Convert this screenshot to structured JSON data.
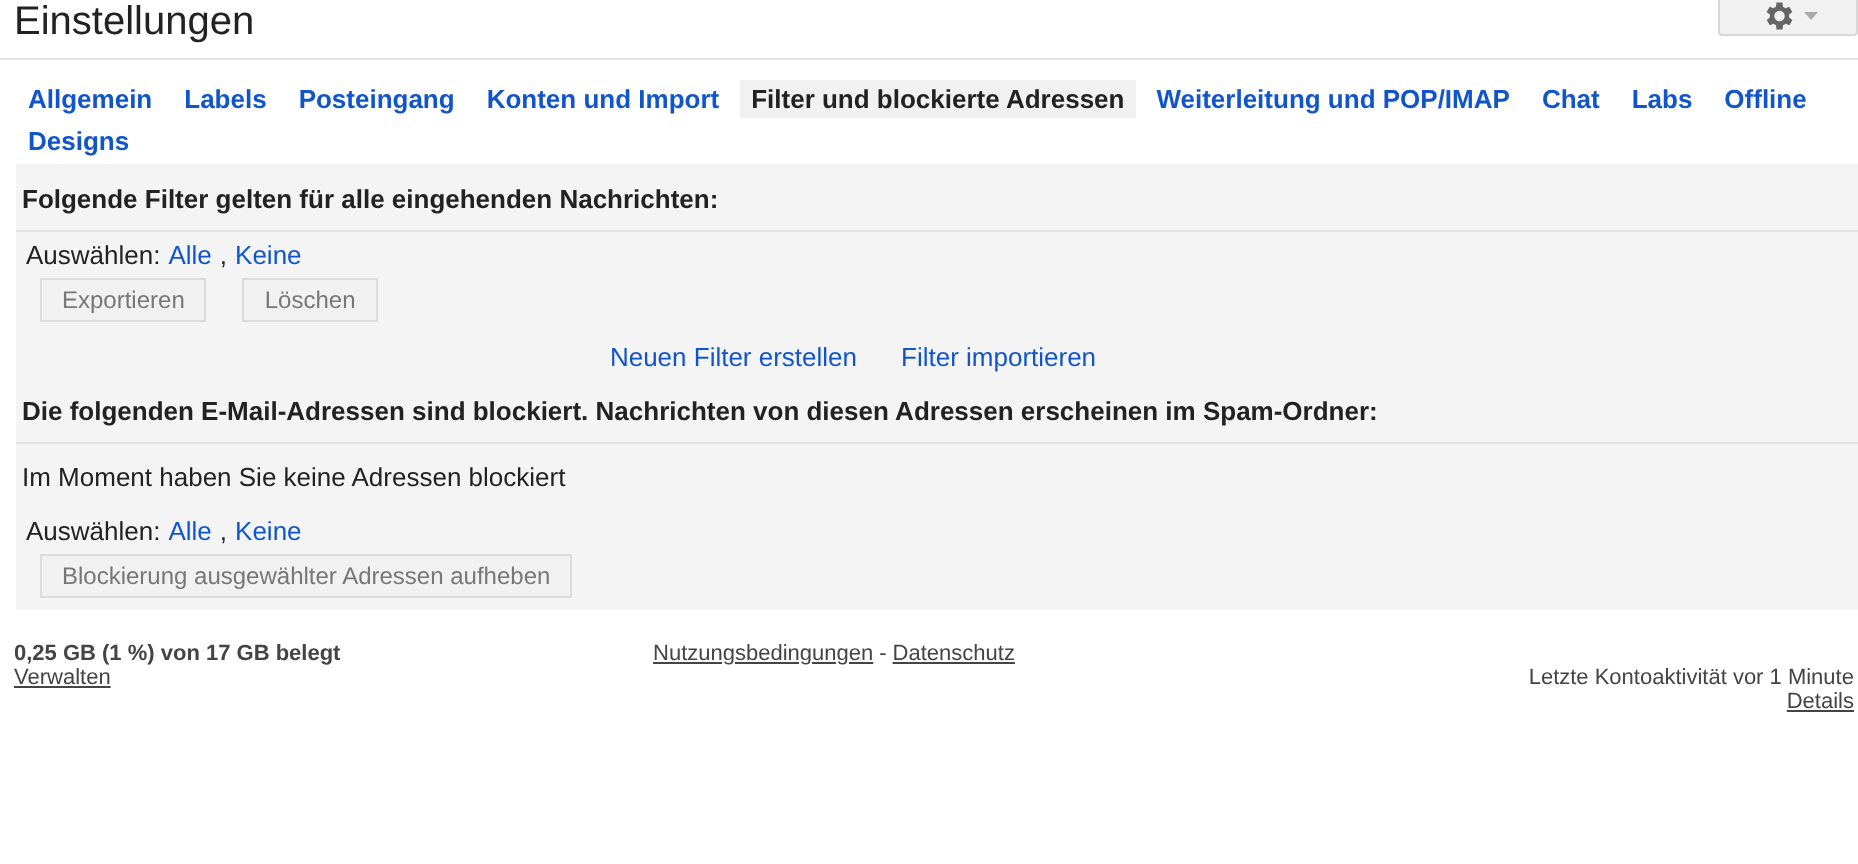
{
  "header": {
    "title": "Einstellungen"
  },
  "tabs": [
    {
      "label": "Allgemein",
      "selected": false
    },
    {
      "label": "Labels",
      "selected": false
    },
    {
      "label": "Posteingang",
      "selected": false
    },
    {
      "label": "Konten und Import",
      "selected": false
    },
    {
      "label": "Filter und blockierte Adressen",
      "selected": true
    },
    {
      "label": "Weiterleitung und POP/IMAP",
      "selected": false
    },
    {
      "label": "Chat",
      "selected": false
    },
    {
      "label": "Labs",
      "selected": false
    },
    {
      "label": "Offline",
      "selected": false
    },
    {
      "label": "Designs",
      "selected": false
    }
  ],
  "filters": {
    "heading": "Folgende Filter gelten für alle eingehenden Nachrichten:",
    "select_label": "Auswählen:",
    "select_all": "Alle",
    "select_comma": ",",
    "select_none": "Keine",
    "buttons": [
      {
        "label": "Exportieren",
        "disabled": true
      },
      {
        "label": "Löschen",
        "disabled": true
      }
    ],
    "links": [
      "Neuen Filter erstellen",
      "Filter importieren"
    ]
  },
  "blocked": {
    "heading": "Die folgenden E-Mail-Adressen sind blockiert. Nachrichten von diesen Adressen erscheinen im Spam-Ordner:",
    "empty_text": "Im Moment haben Sie keine Adressen blockiert",
    "select_label": "Auswählen:",
    "select_all": "Alle",
    "select_comma": ",",
    "select_none": "Keine",
    "buttons": [
      {
        "label": "Blockierung ausgewählter Adressen aufheben",
        "disabled": true
      }
    ]
  },
  "footer": {
    "storage": "0,25 GB (1 %) von 17 GB belegt",
    "manage": "Verwalten",
    "terms": "Nutzungsbedingungen",
    "separator": "-",
    "privacy": "Datenschutz",
    "activity": "Letzte Kontoaktivität vor 1 Minute",
    "details": "Details"
  }
}
